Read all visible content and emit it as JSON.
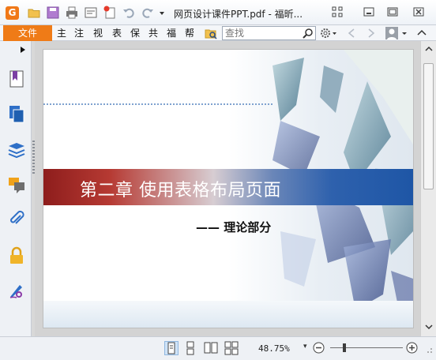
{
  "app": {
    "logo_letter": "G",
    "title": "网页设计课件PPT.pdf - 福昕..."
  },
  "menu": {
    "file_label": "文件",
    "items": [
      "主",
      "注",
      "视",
      "表",
      "保",
      "共",
      "福",
      "帮"
    ],
    "search_placeholder": "查找"
  },
  "slide": {
    "title": "第二章 使用表格布局页面",
    "subtitle": "—— 理论部分"
  },
  "status": {
    "zoom": "48.75%",
    "zoom_caret": "▾"
  },
  "colors": {
    "accent_orange": "#ef7b17",
    "banner_red": "#8e1d1c",
    "banner_blue": "#1e56a6"
  },
  "icons": {
    "quick_access": [
      "open-folder-icon",
      "save-icon",
      "print-icon",
      "properties-icon",
      "new-icon",
      "undo-icon",
      "redo-icon",
      "customize-dropdown-icon"
    ],
    "window": [
      "restore-icon",
      "minimize-icon",
      "maximize-icon",
      "close-icon"
    ],
    "left_panel": [
      "bookmark-icon",
      "pages-icon",
      "layers-icon",
      "comments-icon",
      "attachments-icon",
      "security-icon",
      "signature-icon"
    ],
    "status": [
      "single-page-icon",
      "continuous-icon",
      "facing-icon",
      "continuous-facing-icon"
    ]
  }
}
